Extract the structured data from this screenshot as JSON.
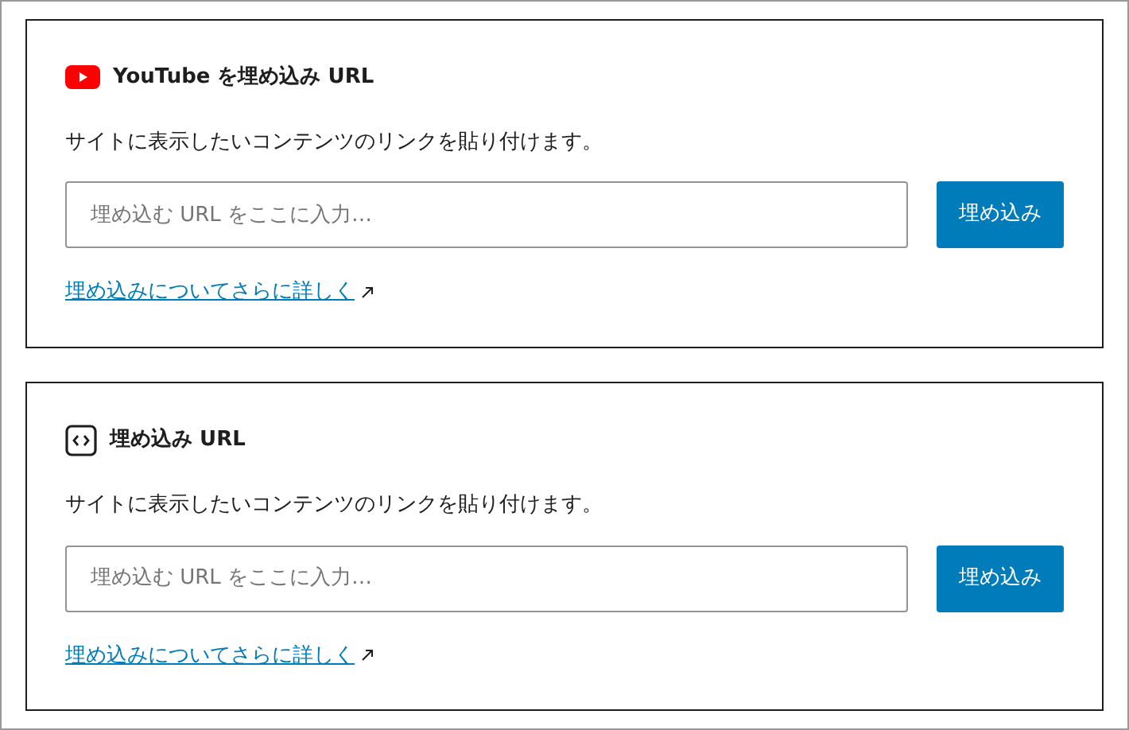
{
  "blocks": [
    {
      "kind": "youtube",
      "title": "YouTube を埋め込み URL",
      "instructions": "サイトに表示したいコンテンツのリンクを貼り付けます。",
      "input": {
        "placeholder": "埋め込む URL をここに入力…"
      },
      "button": "埋め込み",
      "link": "埋め込みについてさらに詳しく"
    },
    {
      "kind": "embed",
      "title": "埋め込み URL",
      "instructions": "サイトに表示したいコンテンツのリンクを貼り付けます。",
      "input": {
        "placeholder": "埋め込む URL をここに入力…"
      },
      "button": "埋め込み",
      "link": "埋め込みについてさらに詳しく"
    }
  ]
}
